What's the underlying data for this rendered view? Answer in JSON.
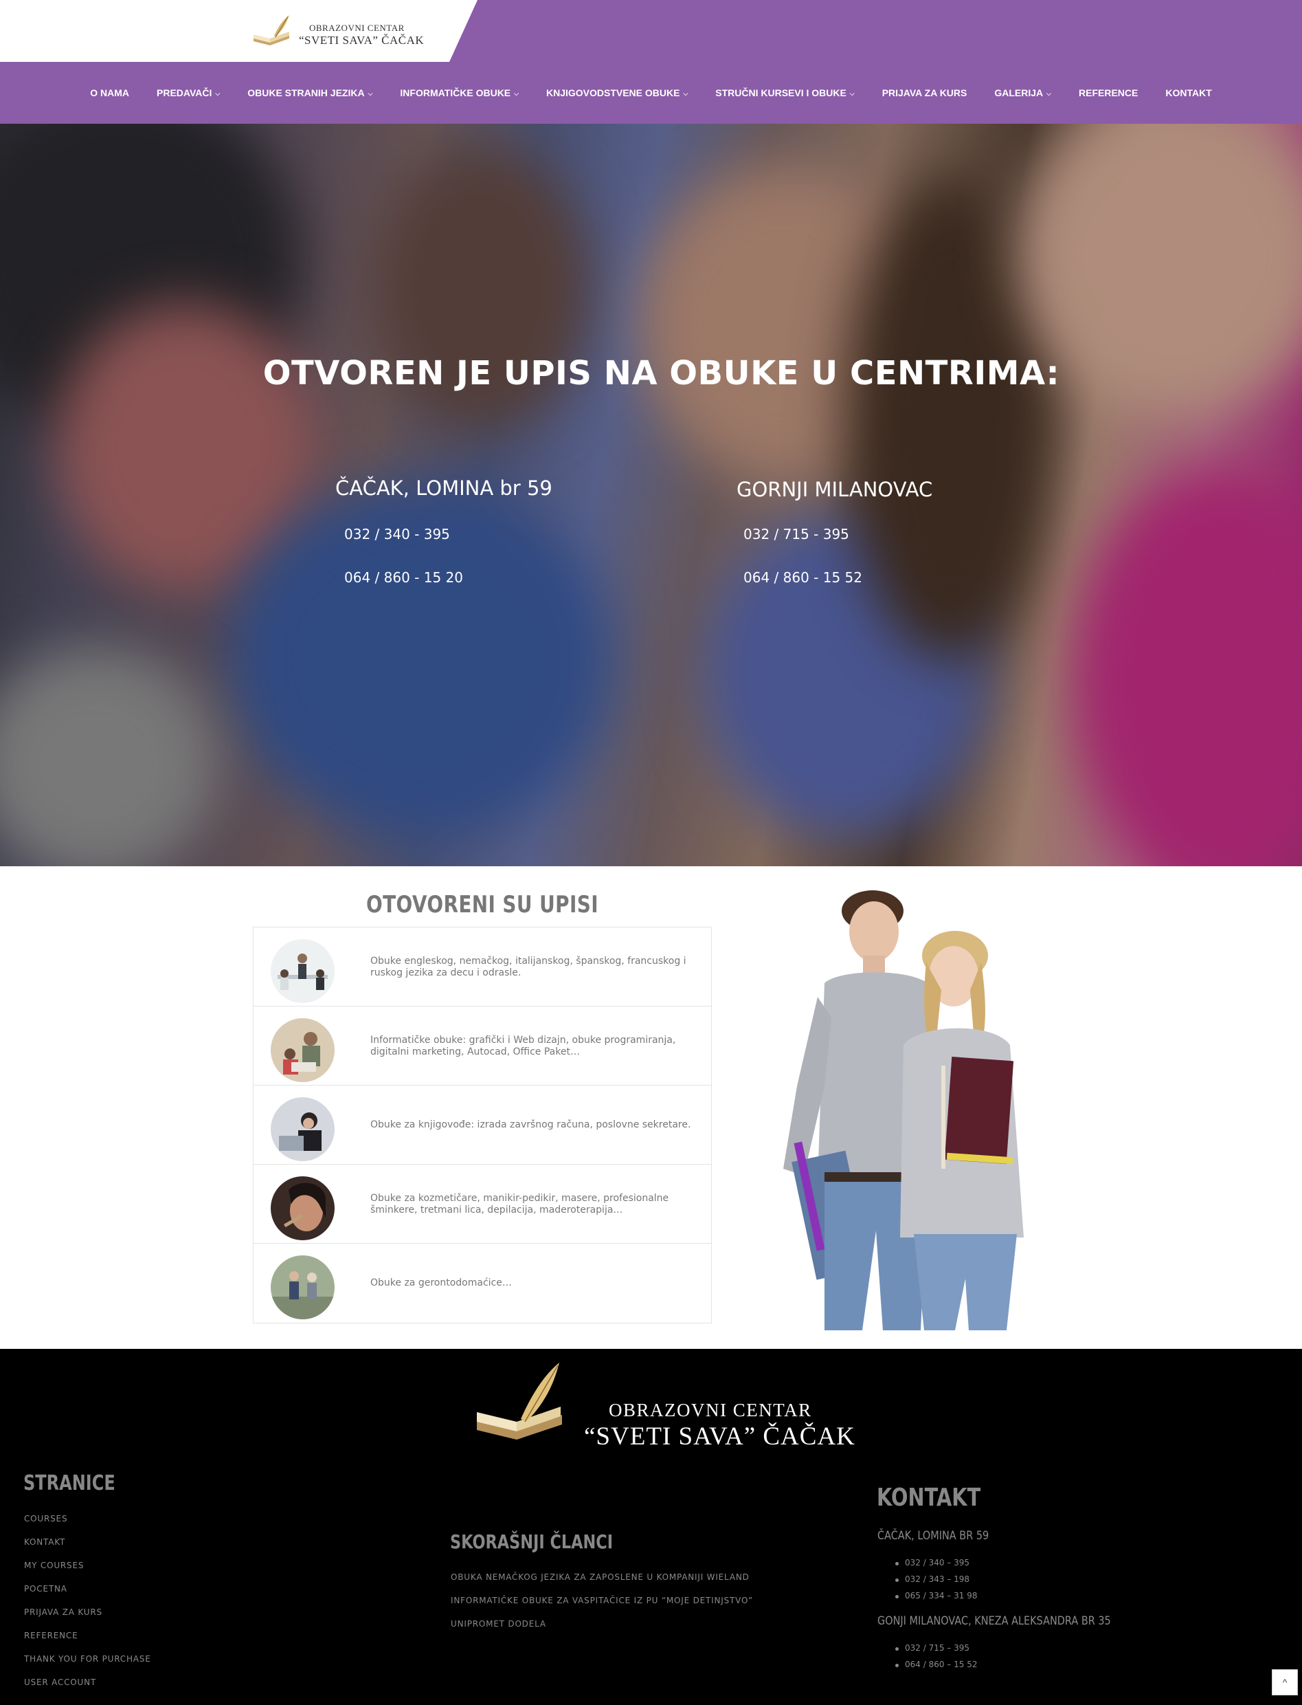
{
  "header": {
    "logo_line1": "OBRAZOVNI CENTAR",
    "logo_line2": "“SVETI SAVA” ČAČAK",
    "nav": [
      {
        "label": "O NAMA",
        "dropdown": false
      },
      {
        "label": "PREDAVAČI",
        "dropdown": true
      },
      {
        "label": "OBUKE STRANIH JEZIKA",
        "dropdown": true
      },
      {
        "label": "INFORMATIČKE OBUKE",
        "dropdown": true
      },
      {
        "label": "KNJIGOVODSTVENE OBUKE",
        "dropdown": true
      },
      {
        "label": "STRUČNI KURSEVI I OBUKE",
        "dropdown": true
      },
      {
        "label": "PRIJAVA ZA KURS",
        "dropdown": false
      },
      {
        "label": "GALERIJA",
        "dropdown": true
      },
      {
        "label": "REFERENCE",
        "dropdown": false
      },
      {
        "label": "KONTAKT",
        "dropdown": false
      }
    ]
  },
  "hero": {
    "title": "OTVOREN JE UPIS NA OBUKE U CENTRIMA:",
    "locations": [
      {
        "name": "ČAČAK, LOMINA br 59",
        "phone1": "032 / 340 - 395",
        "phone2": "064 / 860 - 15 20"
      },
      {
        "name": "GORNJI MILANOVAC",
        "phone1": "032 / 715 - 395",
        "phone2": "064 / 860 - 15 52"
      }
    ]
  },
  "upisi": {
    "title": "OTOVORENI SU UPISI",
    "items": [
      {
        "text": "Obuke engleskog, nemačkog, italijanskog, španskog, francuskog i ruskog jezika za decu i odrasle."
      },
      {
        "text": "Informatičke obuke: grafički i Web dizajn, obuke programiranja, digitalni marketing, Autocad, Office Paket…"
      },
      {
        "text": "Obuke za knjigovođe: izrada završnog računa, poslovne sekretare."
      },
      {
        "text": "Obuke za kozmetičare, manikir-pedikir, masere, profesionalne šminkere, tretmani lica, depilacija, maderoterapija…"
      },
      {
        "text": "Obuke za gerontodomaćice…"
      }
    ]
  },
  "footer": {
    "logo_line1": "OBRAZOVNI CENTAR",
    "logo_line2": "“SVETI SAVA” ČAČAK",
    "stranice": {
      "title": "STRANICE",
      "links": [
        "COURSES",
        "KONTAKT",
        "MY COURSES",
        "POCETNA",
        "PRIJAVA ZA KURS",
        "REFERENCE",
        "THANK YOU FOR PURCHASE",
        "USER ACCOUNT"
      ]
    },
    "clanci": {
      "title": "SKORAŠNJI ČLANCI",
      "links": [
        "OBUKA NEMAČKOG JEZIKA ZA ZAPOSLENE U KOMPANIJI WIELAND",
        "INFORMATIČKE OBUKE ZA VASPITAČICE IZ PU “MOJE DETINJSTVO”",
        "UNIPROMET DODELA"
      ]
    },
    "kontakt": {
      "title": "KONTAKT",
      "loc1": "ČAČAK, LOMINA BR 59",
      "loc1_phones": [
        "032 / 340 – 395",
        "032 / 343 – 198",
        "065 / 334 – 31 98"
      ],
      "loc2": "GONJI MILANOVAC, KNEZA ALEKSANDRA BR 35",
      "loc2_phones": [
        "032 / 715 – 395",
        "064 / 860 – 15 52"
      ]
    },
    "to_top": "^"
  },
  "colors": {
    "brand_purple": "#8b5ca8",
    "footer_bg": "#000000",
    "muted_text": "#777777"
  }
}
